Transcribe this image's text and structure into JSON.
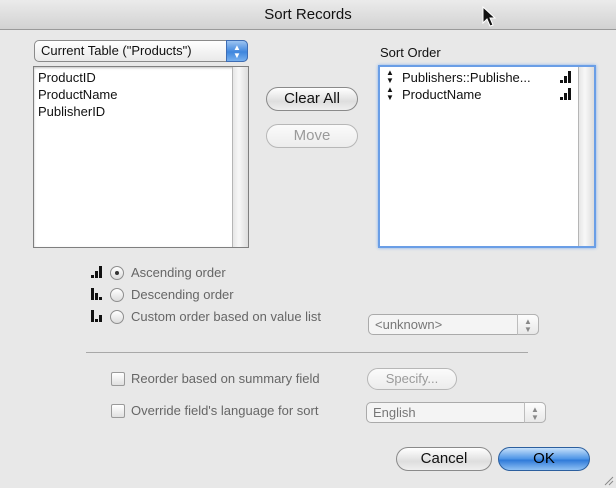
{
  "window": {
    "title": "Sort Records"
  },
  "table_popup": {
    "value": "Current Table (\"Products\")"
  },
  "fields_list": {
    "items": [
      "ProductID",
      "ProductName",
      "PublisherID"
    ]
  },
  "buttons": {
    "clear_all": "Clear All",
    "move": "Move",
    "specify": "Specify...",
    "cancel": "Cancel",
    "ok": "OK"
  },
  "sort_order": {
    "heading": "Sort Order",
    "items": [
      {
        "label": "Publishers::Publishe...",
        "direction": "ascending"
      },
      {
        "label": "ProductName",
        "direction": "ascending"
      }
    ]
  },
  "options": {
    "ascending": "Ascending order",
    "descending": "Descending order",
    "custom": "Custom order based on value list",
    "selected": "ascending",
    "value_list_popup": "<unknown>"
  },
  "checkboxes": {
    "reorder": "Reorder based on summary field",
    "override": "Override field's language for sort",
    "reorder_checked": false,
    "override_checked": false
  },
  "language_popup": {
    "value": "English"
  },
  "colors": {
    "default_button": "#3f86dd",
    "focus_ring": "#6a9ee6"
  }
}
